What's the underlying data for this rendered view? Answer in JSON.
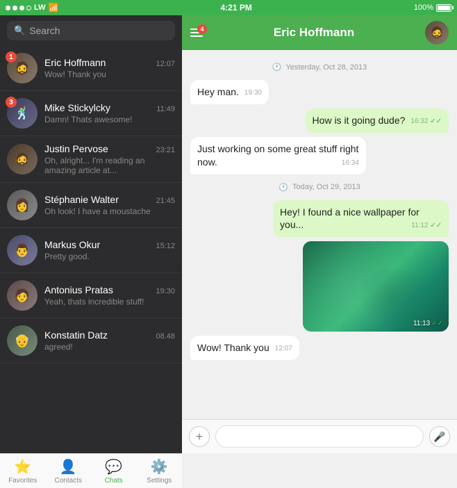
{
  "statusBar": {
    "signal": [
      "full",
      "full",
      "full",
      "empty"
    ],
    "carrier": "LW",
    "time": "4:21 PM",
    "battery": "100%"
  },
  "leftPanel": {
    "search": {
      "placeholder": "Search",
      "icon": "search"
    },
    "chats": [
      {
        "id": 1,
        "name": "Eric Hoffmann",
        "time": "12:07",
        "preview": "Wow! Thank you",
        "badge": 1,
        "face": "face-1",
        "emoji": "🧔"
      },
      {
        "id": 2,
        "name": "Mike Stickylcky",
        "time": "11:49",
        "preview": "Damn! Thats awesome!",
        "badge": 3,
        "face": "face-2",
        "emoji": "🕺"
      },
      {
        "id": 3,
        "name": "Justin Pervose",
        "time": "23:21",
        "preview": "Oh, alright... I'm reading an amazing article at...",
        "badge": 0,
        "face": "face-3",
        "emoji": "🧔"
      },
      {
        "id": 4,
        "name": "Stéphanie Walter",
        "time": "21:45",
        "preview": "Oh look! I have a moustache",
        "badge": 0,
        "face": "face-4",
        "emoji": "👩"
      },
      {
        "id": 5,
        "name": "Markus Okur",
        "time": "15:12",
        "preview": "Pretty good.",
        "badge": 0,
        "face": "face-5",
        "emoji": "👨"
      },
      {
        "id": 6,
        "name": "Antonius Pratas",
        "time": "19:30",
        "preview": "Yeah, thats incredible stuff!",
        "badge": 0,
        "face": "face-6",
        "emoji": "🧑"
      },
      {
        "id": 7,
        "name": "Konstatin Datz",
        "time": "08.48",
        "preview": "agreed!",
        "badge": 0,
        "face": "face-7",
        "emoji": "👴"
      }
    ],
    "nav": [
      {
        "id": "favorites",
        "label": "Favorites",
        "icon": "⭐",
        "active": false
      },
      {
        "id": "contacts",
        "label": "Contacts",
        "icon": "👤",
        "active": false
      },
      {
        "id": "chats",
        "label": "Chats",
        "icon": "💬",
        "active": true
      },
      {
        "id": "settings",
        "label": "Settings",
        "icon": "⚙️",
        "active": false
      }
    ]
  },
  "rightPanel": {
    "header": {
      "title": "Eric Hoffmann",
      "badgeCount": "4",
      "emoji": "🧔"
    },
    "messages": [
      {
        "type": "date-divider",
        "text": "Yesterday, Oct 28, 2013"
      },
      {
        "type": "incoming",
        "text": "Hey man.",
        "time": "19:30"
      },
      {
        "type": "outgoing",
        "text": "How is it going dude?",
        "time": "16:32",
        "ticks": "✓✓"
      },
      {
        "type": "incoming",
        "text": "Just working on some great stuff right now.",
        "time": "16:34"
      },
      {
        "type": "date-divider",
        "text": "Today, Oct 29, 2013"
      },
      {
        "type": "outgoing",
        "text": "Hey! I found a nice wallpaper for you...",
        "time": "11:12",
        "ticks": "✓✓"
      },
      {
        "type": "image",
        "time": "11:13",
        "ticks": "✓✓"
      },
      {
        "type": "incoming",
        "text": "Wow! Thank you",
        "time": "12:07"
      }
    ],
    "inputBar": {
      "addLabel": "+",
      "micLabel": "🎤",
      "placeholder": ""
    }
  }
}
